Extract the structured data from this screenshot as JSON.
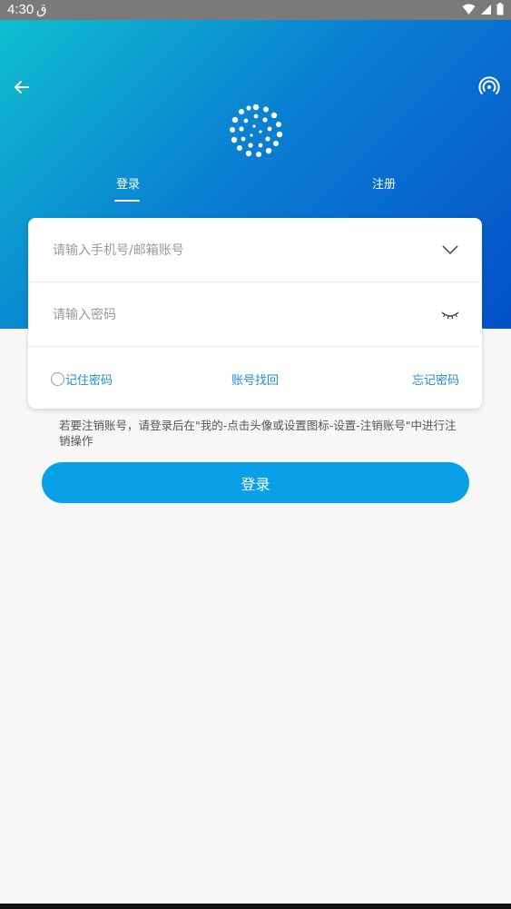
{
  "status_bar": {
    "time": "4:30",
    "app_indicator": "ق",
    "icons": [
      "wifi-icon",
      "signal-icon",
      "battery-icon"
    ]
  },
  "header": {
    "back_icon": "arrow-left-icon",
    "right_icon": "broadcast-icon",
    "logo": "dot-ring-logo"
  },
  "tabs": [
    {
      "label": "登录",
      "active": true
    },
    {
      "label": "注册",
      "active": false
    }
  ],
  "form": {
    "account_placeholder": "请输入手机号/邮箱账号",
    "password_placeholder": "请输入密码",
    "remember_label": "记住密码",
    "recover_label": "账号找回",
    "forgot_label": "忘记密码"
  },
  "notice": "若要注销账号，请登录后在\"我的-点击头像或设置图标-设置-注销账号\"中进行注销操作",
  "login_button": "登录",
  "colors": {
    "accent": "#0aa0e8",
    "link": "#1f8ad8",
    "gradient_start": "#0fbfcf",
    "gradient_end": "#0550c8"
  }
}
